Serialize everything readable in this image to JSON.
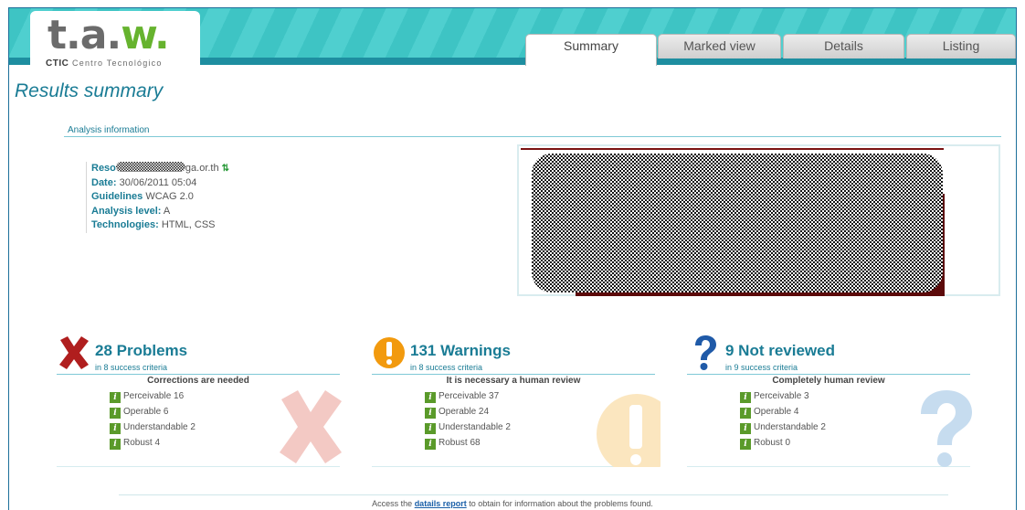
{
  "logo": {
    "text_t": "t",
    "text_a": "a",
    "text_w": "w",
    "dot": ".",
    "org": "CTIC",
    "subtitle": "Centro Tecnológico"
  },
  "tabs": [
    {
      "label": "Summary",
      "active": true
    },
    {
      "label": "Marked view",
      "active": false
    },
    {
      "label": "Details",
      "active": false
    },
    {
      "label": "Listing",
      "active": false
    }
  ],
  "page_title": "Results summary",
  "analysis": {
    "section_label": "Analysis information",
    "resource_label": "Reso",
    "resource_value": "ga.or.th",
    "date_label": "Date:",
    "date_value": "30/06/2011 05:04",
    "guidelines_label": "Guidelines",
    "guidelines_value": "WCAG 2.0",
    "level_label": "Analysis level:",
    "level_value": "A",
    "tech_label": "Technologies:",
    "tech_value": "HTML, CSS"
  },
  "summary": {
    "problems": {
      "title": "28 Problems",
      "sub": "in 8 success criteria",
      "caption": "Corrections are needed",
      "items": [
        "Perceivable 16",
        "Operable 6",
        "Understandable 2",
        "Robust 4"
      ]
    },
    "warnings": {
      "title": "131 Warnings",
      "sub": "in 8 success criteria",
      "caption": "It is necessary a human review",
      "items": [
        "Perceivable 37",
        "Operable 24",
        "Understandable 2",
        "Robust 68"
      ]
    },
    "notreviewed": {
      "title": "9 Not reviewed",
      "sub": "in 9 success criteria",
      "caption": "Completely human review",
      "items": [
        "Perceivable 3",
        "Operable 4",
        "Understandable 2",
        "Robust 0"
      ]
    }
  },
  "footer": {
    "before": "Access the ",
    "link": "datails report",
    "after": " to obtain for information about the problems found."
  },
  "colors": {
    "accent": "#1a7c95",
    "band": "#3ec4c4",
    "problem": "#b01e1e",
    "warning": "#f29a0e",
    "question": "#1f5aa8",
    "info_icon": "#5a9a2a"
  }
}
